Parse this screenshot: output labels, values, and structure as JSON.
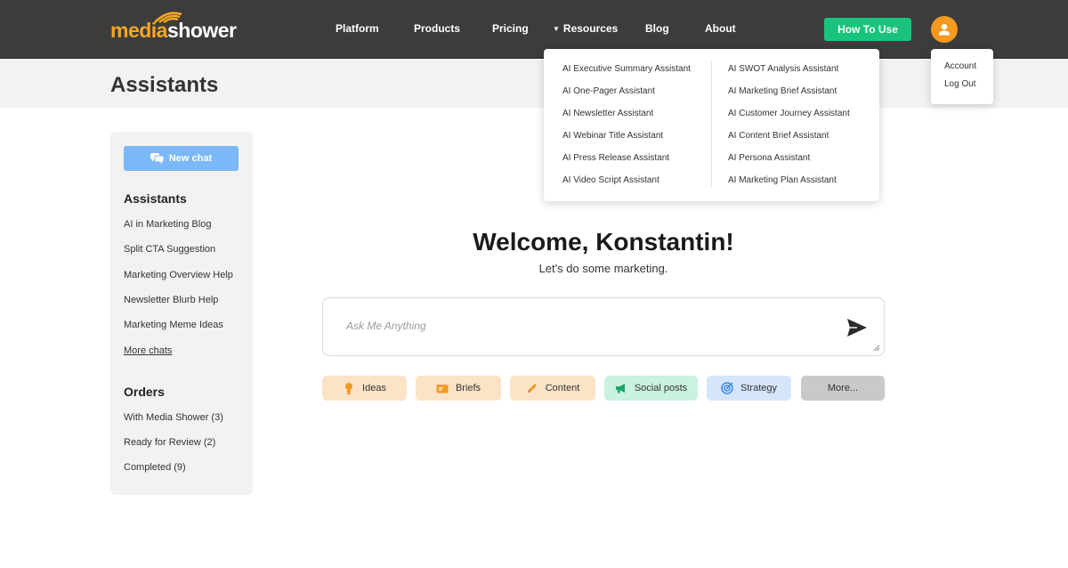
{
  "brand": {
    "logo_part1": "media",
    "logo_part2": "shower"
  },
  "nav": {
    "platform": "Platform",
    "products": "Products",
    "pricing": "Pricing",
    "resources": "Resources",
    "blog": "Blog",
    "about": "About",
    "how_to_use": "How To Use"
  },
  "resources_menu": {
    "left": [
      "AI Executive Summary Assistant",
      "AI One-Pager Assistant",
      "AI Newsletter Assistant",
      "AI Webinar Title Assistant",
      "AI Press Release Assistant",
      "AI Video Script Assistant"
    ],
    "right": [
      "AI SWOT Analysis Assistant",
      "AI Marketing Brief Assistant",
      "AI Customer Journey Assistant",
      "AI Content Brief Assistant",
      "AI Persona Assistant",
      "AI Marketing Plan Assistant"
    ]
  },
  "account_menu": {
    "account": "Account",
    "logout": "Log Out"
  },
  "page": {
    "title": "Assistants"
  },
  "sidebar": {
    "new_chat": "New chat",
    "assistants_heading": "Assistants",
    "chats": [
      "AI in Marketing Blog",
      "Split CTA Suggestion",
      "Marketing Overview Help",
      "Newsletter Blurb Help",
      "Marketing Meme Ideas"
    ],
    "more_chats": "More chats",
    "orders_heading": "Orders",
    "orders": [
      "With Media Shower (3)",
      "Ready for Review (2)",
      "Completed (9)"
    ]
  },
  "main": {
    "welcome": "Welcome, Konstantin!",
    "subtitle": "Let's do some marketing.",
    "input_placeholder": "Ask Me Anything",
    "chips": {
      "ideas": "Ideas",
      "briefs": "Briefs",
      "content": "Content",
      "social": "Social posts",
      "strategy": "Strategy",
      "more": "More..."
    }
  },
  "colors": {
    "nav_bg": "#3c3c3c",
    "accent_orange": "#f59a1f",
    "accent_green": "#19c37d",
    "new_chat_blue": "#7cb7f7",
    "chip_orange": "#fde3c6",
    "chip_green": "#c9f2df",
    "chip_blue": "#d5e6fb",
    "chip_gray": "#c9c9c9"
  },
  "icons": {
    "avatar": "user-icon",
    "new_chat": "chat-bubbles-icon",
    "send": "paper-plane-icon",
    "ideas": "lightbulb-icon",
    "briefs": "briefcase-icon",
    "content": "pencil-icon",
    "social": "megaphone-icon",
    "strategy": "target-icon"
  }
}
